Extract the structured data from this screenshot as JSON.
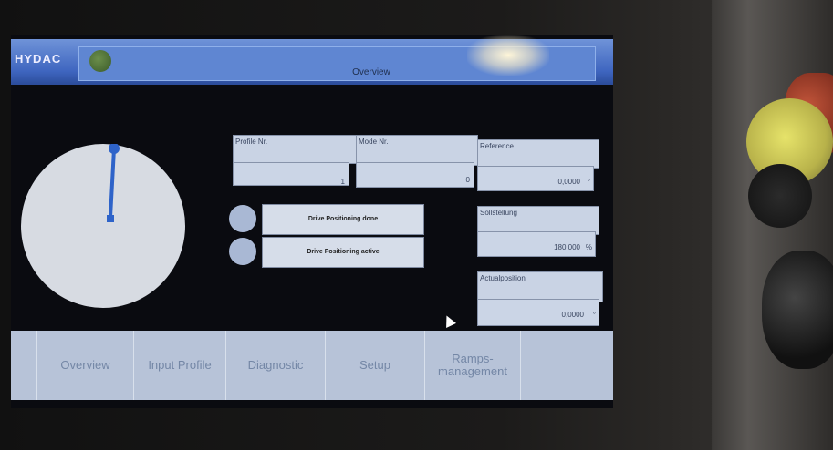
{
  "header": {
    "logo": "HYDAC",
    "title": "Overview"
  },
  "fields": {
    "profile_nr": {
      "label": "Profile Nr.",
      "value": "1"
    },
    "mode_nr": {
      "label": "Mode Nr.",
      "value": "0"
    },
    "reference": {
      "label": "Reference",
      "value": "0,0000",
      "unit": "°"
    },
    "set_position": {
      "label": "Sollstellung",
      "value": "180,000",
      "unit": "%"
    },
    "actual_position": {
      "label": "Actualposition",
      "value": "0,0000",
      "unit": "°"
    }
  },
  "status": {
    "done": "Drive Positioning done",
    "active": "Drive Positioning active"
  },
  "nav": {
    "items": [
      "Overview",
      "Input Profile",
      "Diagnostic",
      "Setup",
      "Ramps-management"
    ]
  },
  "colors": {
    "screen_accent": "#3f66c0",
    "gauge_pointer": "#2e63c9"
  }
}
